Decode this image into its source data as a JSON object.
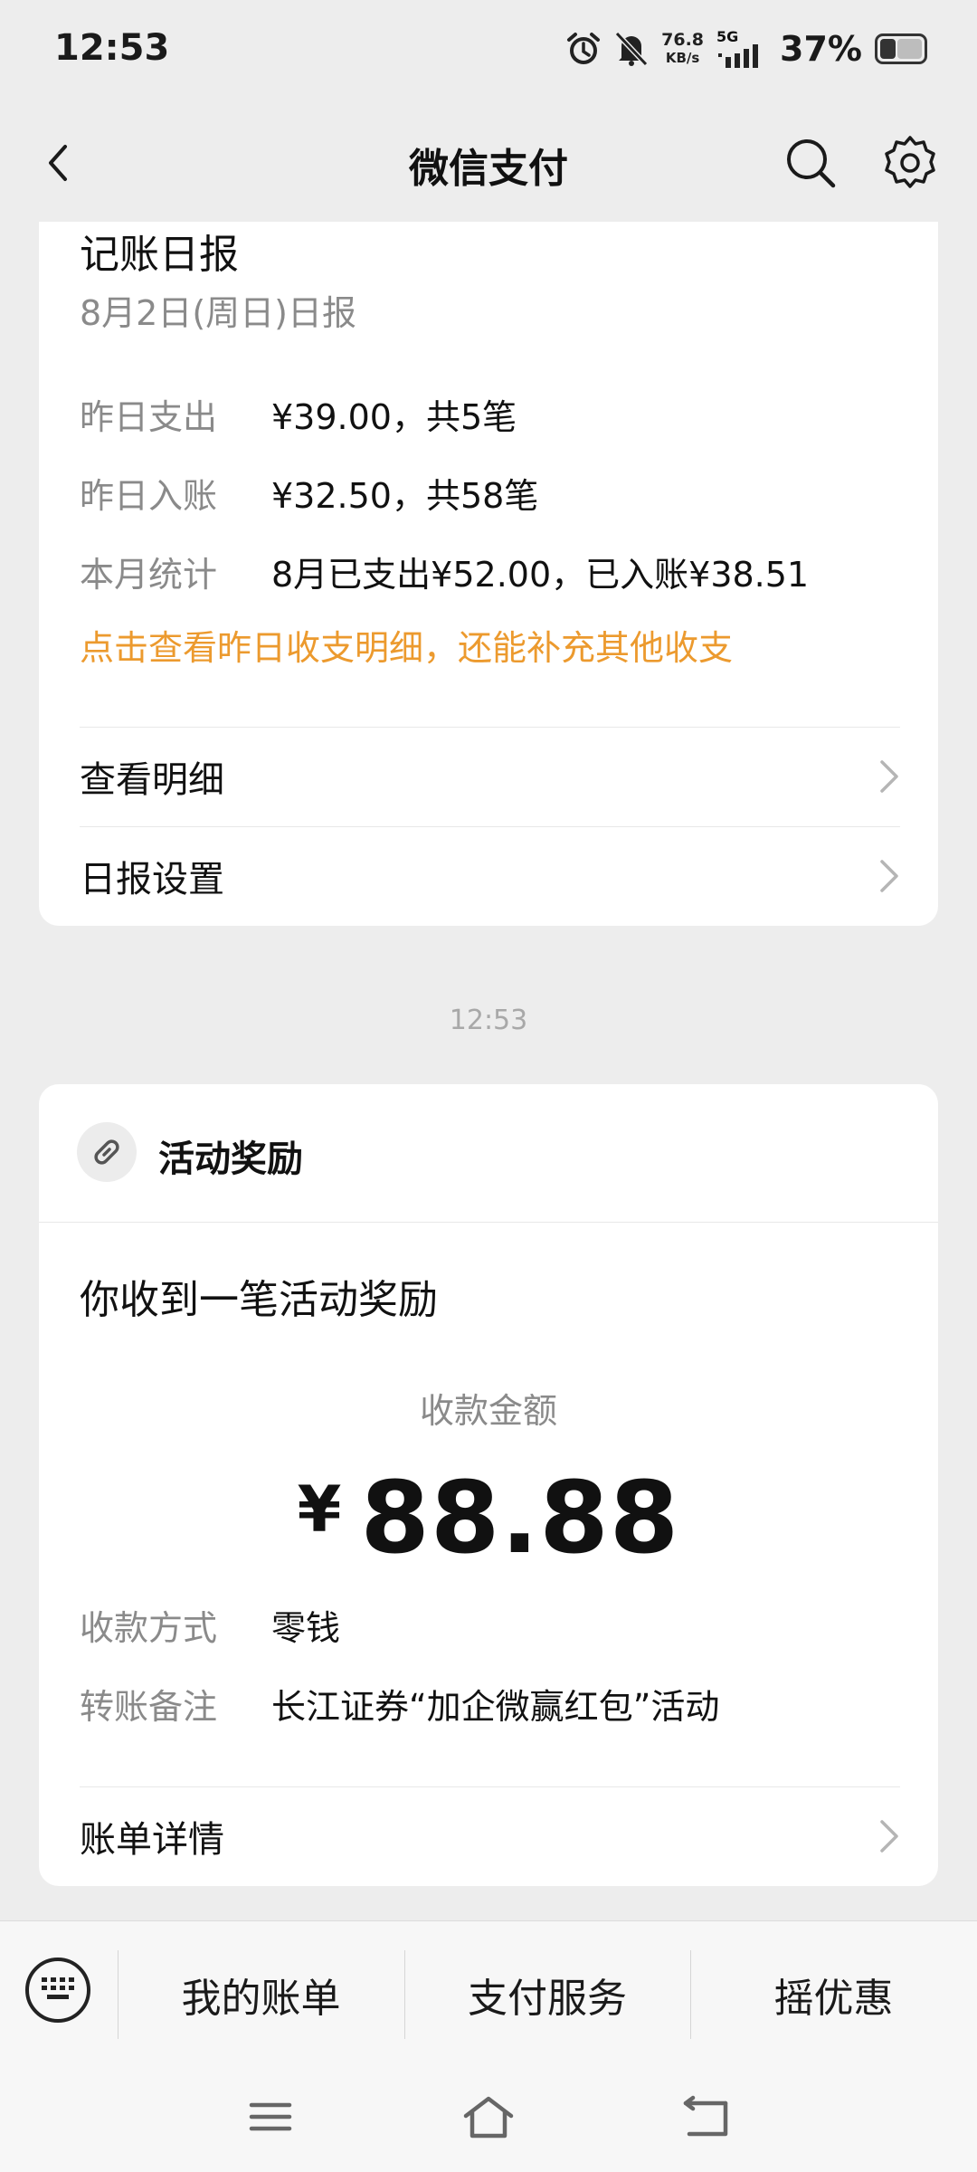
{
  "status_bar": {
    "time": "12:53",
    "net_speed_value": "76.8",
    "net_speed_unit": "KB/s",
    "network": "5G",
    "battery_percent": "37%",
    "battery_level": 0.37,
    "icons": [
      "alarm-icon",
      "mute-icon",
      "signal-icon",
      "battery-icon"
    ]
  },
  "header": {
    "title": "微信支付",
    "back_icon": "chevron-left-icon",
    "search_icon": "search-icon",
    "settings_icon": "gear-icon"
  },
  "daily_report": {
    "title": "记账日报",
    "date": "8月2日(周日)日报",
    "rows": [
      {
        "label": "昨日支出",
        "value": "¥39.00，共5笔"
      },
      {
        "label": "昨日入账",
        "value": "¥32.50，共58笔"
      },
      {
        "label": "本月统计",
        "value": "8月已支出¥52.00，已入账¥38.51"
      }
    ],
    "hint": "点击查看昨日收支明细，还能补充其他收支",
    "links": [
      "查看明细",
      "日报设置"
    ]
  },
  "timestamp": "12:53",
  "reward": {
    "header_title": "活动奖励",
    "message": "你收到一笔活动奖励",
    "amount_label": "收款金额",
    "currency": "¥",
    "amount": "88.88",
    "rows": [
      {
        "label": "收款方式",
        "value": "零钱"
      },
      {
        "label": "转账备注",
        "value": "长江证券“加企微赢红包”活动"
      }
    ],
    "detail_link": "账单详情"
  },
  "bottom_menu": {
    "items": [
      "我的账单",
      "支付服务",
      "摇优惠"
    ]
  },
  "colors": {
    "accent_orange": "#ec9a2e",
    "background": "#ededed",
    "card": "#ffffff"
  }
}
